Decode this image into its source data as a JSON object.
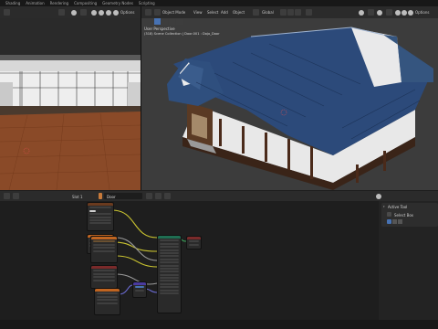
{
  "workspace_tabs": [
    "Shading",
    "Animation",
    "Rendering",
    "Compositing",
    "Geometry Nodes",
    "Scripting"
  ],
  "left_viewport": {
    "options_label": "Options"
  },
  "right_viewport": {
    "mode_label": "Object Mode",
    "menus": [
      "View",
      "Select",
      "Add",
      "Object"
    ],
    "orientation_label": "Global",
    "options_label": "Options",
    "overlay_title": "User Perspective",
    "overlay_subtitle": "(318) Scene Collection | Door.001 : Dojo_Door"
  },
  "node_editor": {
    "slot_label": "Slot 1",
    "material_name": "Door"
  },
  "tool_panel": {
    "header": "Active Tool",
    "tool_name": "Select Box"
  },
  "colors": {
    "accent": "#4772b3",
    "roof": "#2c4a7a",
    "floor": "#8a4a28",
    "link_yellow": "#c9c330",
    "link_gray": "#9a9a9a",
    "link_purple": "#6a6ad0",
    "node_header_orange": "#c06420",
    "node_header_green": "#1f6e52",
    "node_header_red": "#7a2a2a"
  }
}
